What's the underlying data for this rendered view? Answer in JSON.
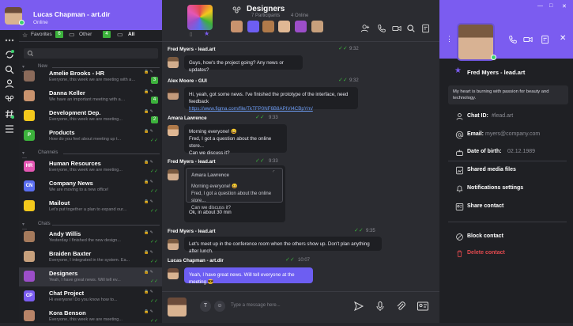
{
  "header": {
    "name": "Lucas Chapman - art.dir",
    "status": "Online"
  },
  "filters": {
    "favorites": {
      "label": "Favorites",
      "count": "6"
    },
    "other": {
      "label": "Other",
      "count": "4"
    },
    "all": {
      "label": "All"
    }
  },
  "sections": {
    "new": "New",
    "channels": "Channels",
    "chats": "Chats"
  },
  "chats": [
    {
      "name": "Amelie Brooks - HR",
      "preview": "Everyone, this week we are meeting with a…",
      "badge": "3",
      "color": "#8a6a5a"
    },
    {
      "name": "Danna Keller",
      "preview": "We have an important meeting with a…",
      "badge": "4",
      "color": "#c9936e"
    },
    {
      "name": "Development Dep.",
      "preview": "Everyone, this week we are meeting...",
      "badge": "2",
      "color": "#f3c81c"
    },
    {
      "name": "Products",
      "preview": "How do you feel about meeting up t...",
      "badge": "",
      "color": "#3cb13c",
      "letter": "P"
    },
    {
      "name": "Human Resources",
      "preview": "Everyone, this week we are meeting...",
      "badge": "",
      "color": "#e557b3",
      "letter": "HR"
    },
    {
      "name": "Company News",
      "preview": "We are moving to a new office!",
      "badge": "",
      "color": "#5a6ef0",
      "letter": "CN"
    },
    {
      "name": "Mailout",
      "preview": "Let's put together a plan to expand our...",
      "badge": "",
      "color": "#f3c81c"
    },
    {
      "name": "Andy Willis",
      "preview": "Yesterday I finished the new design...",
      "badge": "",
      "color": "#a57a5c"
    },
    {
      "name": "Braiden Baxter",
      "preview": "Everyone, I integrated in the system. Ea...",
      "badge": "",
      "color": "#c7a07c"
    },
    {
      "name": "Designers",
      "preview": "Yeah, I have great news. Will tell ev...",
      "badge": "",
      "color": "#9c4ec9"
    },
    {
      "name": "Chat Project",
      "preview": "Hi everyone! Do you know how to...",
      "badge": "",
      "color": "#7b5cf0",
      "letter": "CP"
    },
    {
      "name": "Kora Benson",
      "preview": "Everyone, this week we are meeting...",
      "badge": "",
      "color": "#b88468"
    }
  ],
  "chat": {
    "title": "Designers",
    "participants": "7 Participants",
    "online": "4 Online",
    "composer_placeholder": "Type a message here...",
    "messages": [
      {
        "sender": "Fred Myers - lead.art",
        "time": "9:32",
        "text": "Guys, how's the project going? Any news or updates?"
      },
      {
        "sender": "Alex Moore - GUI",
        "time": "9:32",
        "text": "Hi, yeah, got some news. I've finished the prototype of the interface, need feedback",
        "link": "https://www.figma.com/file/TkTFP0NF6B8APIVI4CBpYm/"
      },
      {
        "sender": "Amara Lawrence",
        "time": "9:33",
        "line1": "Morning everyone! 😀",
        "line2": "Fred, I got a question about the online store...",
        "line3": "Can we discuss it?"
      },
      {
        "sender": "Fred Myers - lead.art",
        "time": "9:33",
        "quote_sender": "Amara Lawrence",
        "quote1": "Morning everyone! 😀",
        "quote2": "Fred, I got a question about the online store...",
        "quote3": "Can we discuss it?",
        "reply": "Ok, in about 30 min"
      },
      {
        "sender": "Fred Myers - lead.art",
        "time": "9:35",
        "text": "Let's meet up in the conference room when the others show up. Don't plan anything after lunch."
      },
      {
        "sender": "Lucas Chapman - art.dir",
        "time": "10:07",
        "text": "Yeah, I have great news. Will tell everyone at the meeting 😎"
      }
    ]
  },
  "profile": {
    "name": "Fred Myers - lead.art",
    "bio": "My heart is burning with passion for beauty and technology.",
    "chat_id_label": "Chat ID:",
    "chat_id": "#lead.art",
    "email_label": "Email:",
    "email": "myers@company.com",
    "dob_label": "Date of birth:",
    "dob": "02.12.1989",
    "shared_media": "Shared media files",
    "notifications": "Notifications settings",
    "share_contact": "Share contact",
    "block": "Block contact",
    "delete": "Delete contact"
  },
  "colors": {
    "accent": "#7b5cf0",
    "green": "#3cb13c",
    "danger": "#e2494e"
  }
}
